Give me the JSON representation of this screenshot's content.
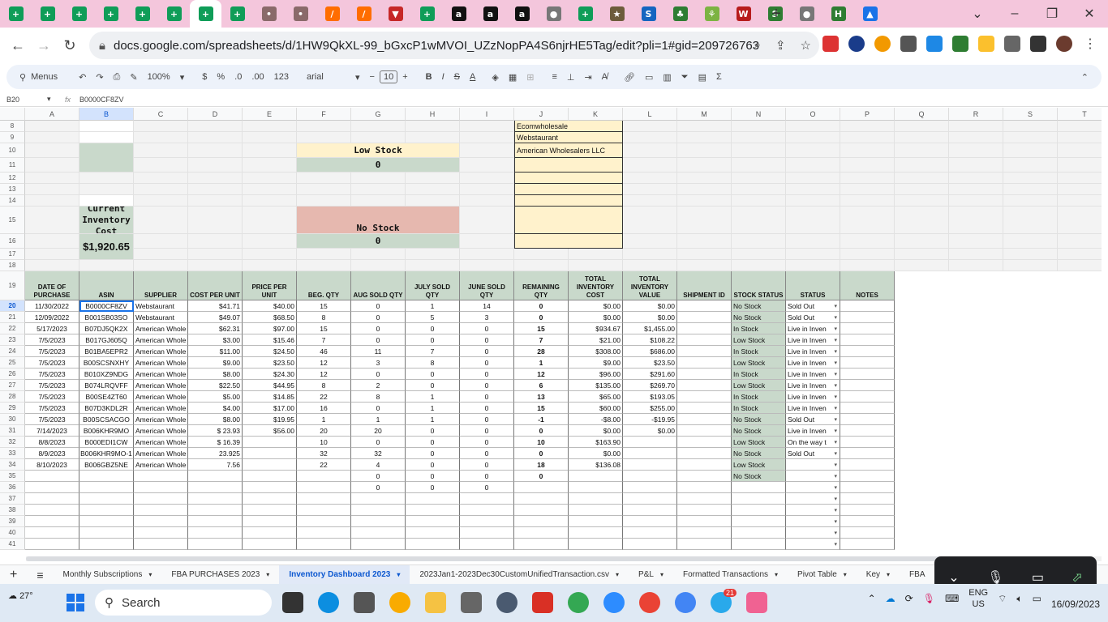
{
  "browser": {
    "tabs": [
      {
        "c": "#0f9d58",
        "t": "+"
      },
      {
        "c": "#0f9d58",
        "t": "+"
      },
      {
        "c": "#0f9d58",
        "t": "+"
      },
      {
        "c": "#0f9d58",
        "t": "+"
      },
      {
        "c": "#0f9d58",
        "t": "+"
      },
      {
        "c": "#0f9d58",
        "t": "+"
      },
      {
        "c": "#0f9d58",
        "t": "+",
        "active": true
      },
      {
        "c": "#0f9d58",
        "t": "+"
      },
      {
        "c": "#8a6a6a",
        "t": "•"
      },
      {
        "c": "#8a6a6a",
        "t": "•"
      },
      {
        "c": "#ff6d00",
        "t": "/"
      },
      {
        "c": "#ff6d00",
        "t": "/"
      },
      {
        "c": "#c62828",
        "t": "▼"
      },
      {
        "c": "#0f9d58",
        "t": "+"
      },
      {
        "c": "#111111",
        "t": "a"
      },
      {
        "c": "#111111",
        "t": "a"
      },
      {
        "c": "#111111",
        "t": "a"
      },
      {
        "c": "#777777",
        "t": "●"
      },
      {
        "c": "#0f9d58",
        "t": "+"
      },
      {
        "c": "#6d5c3b",
        "t": "★"
      },
      {
        "c": "#1565c0",
        "t": "S"
      },
      {
        "c": "#2e7d32",
        "t": "♣"
      },
      {
        "c": "#7cb342",
        "t": "⚘"
      },
      {
        "c": "#b71c1c",
        "t": "W"
      },
      {
        "c": "#2e7d32",
        "t": "S"
      },
      {
        "c": "#777777",
        "t": "●"
      },
      {
        "c": "#2e7d32",
        "t": "H"
      },
      {
        "c": "#1a73e8",
        "t": "▲"
      }
    ],
    "url": "docs.google.com/spreadsheets/d/1HW9QkXL-99_bGxcP1wMVOI_UZzNopPA4S6njrHE5Tag/edit?pli=1#gid=209726763"
  },
  "toolbar": {
    "menus": "Menus",
    "zoom": "100%",
    "currency": "$",
    "percent": "%",
    "dec_less": ".0",
    "dec_more": ".00",
    "num": "123",
    "font": "arial",
    "font_size": "10"
  },
  "formula": {
    "cellref": "B20",
    "fx": "fx",
    "value": "B0000CF8ZV"
  },
  "columns": [
    "A",
    "B",
    "C",
    "D",
    "E",
    "F",
    "G",
    "H",
    "I",
    "J",
    "K",
    "L",
    "M",
    "N",
    "O",
    "P",
    "Q",
    "R",
    "S",
    "T"
  ],
  "top": {
    "suppliers": [
      "Ecomwholesale",
      "Webstaurant",
      "American Wholesalers LLC"
    ],
    "low_stock_label": "Low Stock",
    "low_stock_val": "0",
    "no_stock_label": "No Stock",
    "no_stock_val": "0",
    "inv_cost_label": "Current Inventory Cost",
    "inv_cost_val": "$1,920.65"
  },
  "table": {
    "headers": [
      "DATE OF PURCHASE",
      "ASIN",
      "SUPPLIER",
      "COST PER UNIT",
      "PRICE PER UNIT",
      "BEG. QTY",
      "AUG SOLD QTY",
      "JULY SOLD QTY",
      "JUNE SOLD QTY",
      "REMAINING QTY",
      "TOTAL INVENTORY COST",
      "TOTAL INVENTORY VALUE",
      "SHIPMENT ID",
      "STOCK STATUS",
      "STATUS",
      "NOTES"
    ],
    "rows": [
      [
        "11/30/2022",
        "B0000CF8ZV",
        "Webstaurant",
        "$41.71",
        "$40.00",
        "15",
        "0",
        "1",
        "14",
        "0",
        "$0.00",
        "$0.00",
        "",
        "No Stock",
        "Sold Out"
      ],
      [
        "12/09/2022",
        "B001SB03SO",
        "Webstaurant",
        "$49.07",
        "$68.50",
        "8",
        "0",
        "5",
        "3",
        "0",
        "$0.00",
        "$0.00",
        "",
        "No Stock",
        "Sold Out"
      ],
      [
        "5/17/2023",
        "B07DJ5QK2X",
        "American Whole",
        "$62.31",
        "$97.00",
        "15",
        "0",
        "0",
        "0",
        "15",
        "$934.67",
        "$1,455.00",
        "",
        "In Stock",
        "Live in Inven"
      ],
      [
        "7/5/2023",
        "B017GJ605Q",
        "American Whole",
        "$3.00",
        "$15.46",
        "7",
        "0",
        "0",
        "0",
        "7",
        "$21.00",
        "$108.22",
        "",
        "Low Stock",
        "Live in Inven"
      ],
      [
        "7/5/2023",
        "B01BA5EPR2",
        "American Whole",
        "$11.00",
        "$24.50",
        "46",
        "11",
        "7",
        "0",
        "28",
        "$308.00",
        "$686.00",
        "",
        "In Stock",
        "Live in Inven"
      ],
      [
        "7/5/2023",
        "B00SCSNXHY",
        "American Whole",
        "$9.00",
        "$23.50",
        "12",
        "3",
        "8",
        "0",
        "1",
        "$9.00",
        "$23.50",
        "",
        "Low Stock",
        "Live in Inven"
      ],
      [
        "7/5/2023",
        "B010XZ9NDG",
        "American Whole",
        "$8.00",
        "$24.30",
        "12",
        "0",
        "0",
        "0",
        "12",
        "$96.00",
        "$291.60",
        "",
        "In Stock",
        "Live in Inven"
      ],
      [
        "7/5/2023",
        "B074LRQVFF",
        "American Whole",
        "$22.50",
        "$44.95",
        "8",
        "2",
        "0",
        "0",
        "6",
        "$135.00",
        "$269.70",
        "",
        "Low Stock",
        "Live in Inven"
      ],
      [
        "7/5/2023",
        "B00SE4ZT60",
        "American Whole",
        "$5.00",
        "$14.85",
        "22",
        "8",
        "1",
        "0",
        "13",
        "$65.00",
        "$193.05",
        "",
        "In Stock",
        "Live in Inven"
      ],
      [
        "7/5/2023",
        "B07D3KDL2R",
        "American Whole",
        "$4.00",
        "$17.00",
        "16",
        "0",
        "1",
        "0",
        "15",
        "$60.00",
        "$255.00",
        "",
        "In Stock",
        "Live in Inven"
      ],
      [
        "7/5/2023",
        "B00SCSACGO",
        "American Whole",
        "$8.00",
        "$19.95",
        "1",
        "1",
        "1",
        "0",
        "-1",
        "-$8.00",
        "-$19.95",
        "",
        "No Stock",
        "Sold Out"
      ],
      [
        "7/14/2023",
        "B006KHR9MO",
        "American Whole",
        "$ 23.93",
        "$56.00",
        "20",
        "20",
        "0",
        "0",
        "0",
        "$0.00",
        "$0.00",
        "",
        "No Stock",
        "Live in Inven"
      ],
      [
        "8/8/2023",
        "B000EDI1CW",
        "American Whole",
        "$ 16.39",
        "",
        "10",
        "0",
        "0",
        "0",
        "10",
        "$163.90",
        "",
        "",
        "Low Stock",
        "On the way t"
      ],
      [
        "8/9/2023",
        "B006KHR9MO-1",
        "American Whole",
        "23.925",
        "",
        "32",
        "32",
        "0",
        "0",
        "0",
        "$0.00",
        "",
        "",
        "No Stock",
        "Sold Out"
      ],
      [
        "8/10/2023",
        "B006GBZ5NE",
        "American Whole",
        "7.56",
        "",
        "22",
        "4",
        "0",
        "0",
        "18",
        "$136.08",
        "",
        "",
        "Low Stock",
        ""
      ],
      [
        "",
        "",
        "",
        "",
        "",
        "",
        "0",
        "0",
        "0",
        "0",
        "",
        "",
        "",
        "No Stock",
        ""
      ],
      [
        "",
        "",
        "",
        "",
        "",
        "",
        "0",
        "0",
        "0",
        "",
        "",
        "",
        "",
        "",
        ""
      ]
    ]
  },
  "sheets": [
    "Monthly Subscriptions",
    "FBA PURCHASES 2023",
    "Inventory Dashboard 2023",
    "2023Jan1-2023Dec30CustomUnifiedTransaction.csv",
    "P&L",
    "Formatted Transactions",
    "Pivot Table",
    "Key",
    "FBA"
  ],
  "active_sheet": "Inventory Dashboard 2023",
  "taskbar": {
    "weather": "27°",
    "search": "Search",
    "lang1": "ENG",
    "lang2": "US",
    "date": "16/09/2023",
    "notif": "21"
  }
}
